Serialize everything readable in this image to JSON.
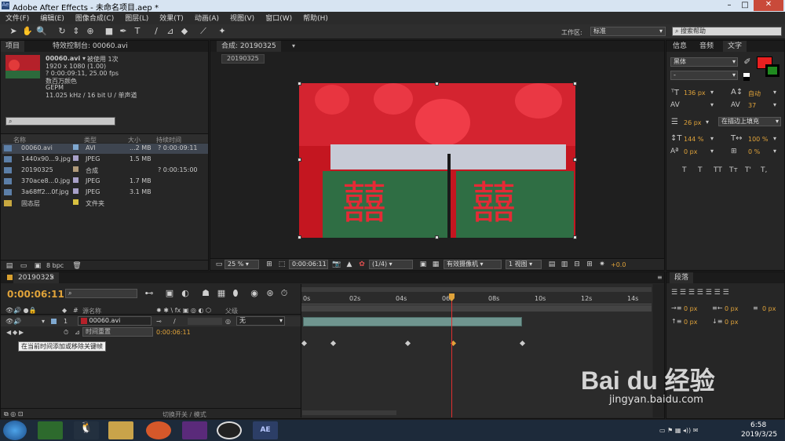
{
  "window": {
    "title": "Adobe After Effects - 未命名项目.aep *"
  },
  "menu": [
    "文件(F)",
    "编辑(E)",
    "图像合成(C)",
    "图层(L)",
    "效果(T)",
    "动画(A)",
    "视图(V)",
    "窗口(W)",
    "帮助(H)"
  ],
  "toolbar": {
    "workspace_label": "工作区:",
    "workspace_value": "标准",
    "search_placeholder": "搜索帮助"
  },
  "project": {
    "tab_project": "项目",
    "tab_effects": "特效控制台: 00060.avi",
    "file_name": "00060.avi ▾",
    "used": "被使用 1次",
    "info_lines": [
      "1920 x 1080 (1.00)",
      "? 0:00:09:11, 25.00 fps",
      "数百万颜色",
      "GEPM",
      "11.025 kHz / 16 bit U / 单声道"
    ],
    "columns": [
      "名称",
      "类型",
      "大小",
      "持续时间"
    ],
    "items": [
      {
        "name": "00060.avi",
        "type": "AVI",
        "size": "...2 MB",
        "duration": "? 0:00:09:11",
        "color": "#7fa8d0"
      },
      {
        "name": "1440x90...9.jpg",
        "type": "JPEG",
        "size": "1.5 MB",
        "duration": "",
        "color": "#a8a0c8"
      },
      {
        "name": "20190325",
        "type": "合成",
        "size": "",
        "duration": "? 0:00:15:00",
        "color": "#b09a7a"
      },
      {
        "name": "370ace8...0.jpg",
        "type": "JPEG",
        "size": "1.7 MB",
        "duration": "",
        "color": "#a8a0c8"
      },
      {
        "name": "3a68ff2...0f.jpg",
        "type": "JPEG",
        "size": "3.1 MB",
        "duration": "",
        "color": "#a8a0c8"
      },
      {
        "name": "固态层",
        "type": "文件夹",
        "size": "",
        "duration": "",
        "color": "#d8c040"
      }
    ],
    "bpc": "8 bpc"
  },
  "composition": {
    "tab": "合成: 20190325",
    "breadcrumb": "20190325",
    "zoom": "25 %",
    "timecode": "0:00:06:11",
    "resolution": "(1/4)",
    "camera": "有效摄像机",
    "views": "1 视图",
    "offset": "+0.0"
  },
  "info_panel": {
    "tabs": [
      "信息",
      "音频",
      "文字"
    ],
    "font": "黑体",
    "style": "-",
    "size": "136 px",
    "leading": "自动",
    "kerning": "",
    "tracking": "37",
    "stroke": "26 px",
    "stroke_mode": "在描边上填充",
    "vscale": "144 %",
    "hscale": "100 %",
    "baseline": "0 px",
    "tsume": "0 %",
    "styles": [
      "T",
      "T",
      "TT",
      "Tт",
      "T'",
      "T,"
    ]
  },
  "timeline": {
    "tab": "20190325",
    "timecode": "0:00:06:11",
    "ruler": [
      "0s",
      "02s",
      "04s",
      "06s",
      "08s",
      "10s",
      "12s",
      "14s"
    ],
    "source_header": "源名称",
    "parent_header": "父级",
    "layer_num": "1",
    "layer_name": "00060.avi",
    "parent": "无",
    "prop_name": "时间重置",
    "prop_value": "0:00:06:11",
    "tooltip": "在当前时间添加或移除关键帧",
    "footer": "切换开关 / 模式"
  },
  "paragraph": {
    "tab": "段落",
    "values": [
      "0 px",
      "0 px",
      "0 px",
      "0 px",
      "0 px"
    ]
  },
  "watermark": {
    "logo": "Bai du 经验",
    "url": "jingyan.baidu.com"
  },
  "taskbar": {
    "time": "6:58",
    "date": "2019/3/25",
    "ae_label": "AE"
  }
}
